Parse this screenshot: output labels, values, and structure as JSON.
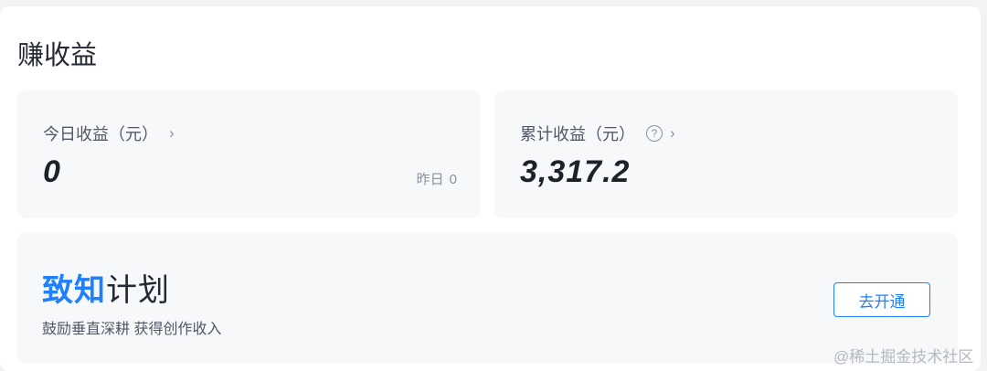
{
  "panel": {
    "title": "赚收益"
  },
  "today_card": {
    "label": "今日收益（元）",
    "chevron": "›",
    "value": "0",
    "yesterday_label": "昨日",
    "yesterday_value": "0"
  },
  "total_card": {
    "label": "累计收益（元）",
    "help": "?",
    "chevron": "›",
    "value": "3,317.2"
  },
  "plan_card": {
    "logo_part1": "致知",
    "logo_part2": "计划",
    "description": "鼓励垂直深耕 获得创作收入",
    "button_label": "去开通"
  },
  "watermark": "@稀土掘金技术社区",
  "colors": {
    "accent": "#1e80ff",
    "card_bg": "#f7f8fa",
    "text_primary": "#252933",
    "text_secondary": "#515767"
  }
}
